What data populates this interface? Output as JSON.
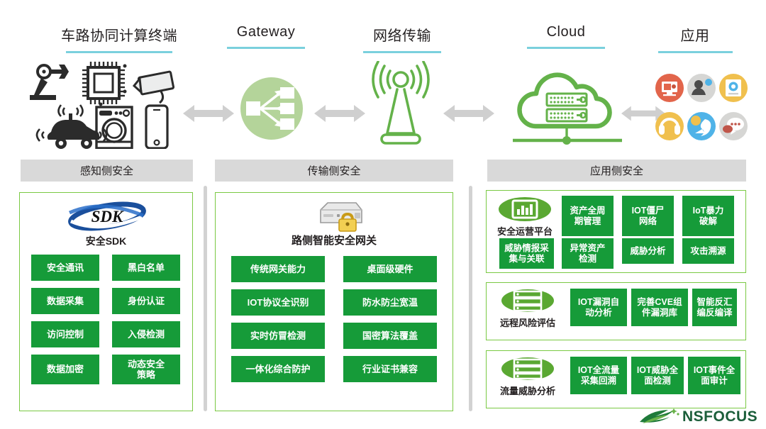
{
  "diagram": {
    "title": "IoT / V2X Security Architecture",
    "accent_green": "#169b39",
    "panel_border_green": "#7ac943",
    "underline_color": "#7ad0dd",
    "banner_bg": "#d9d9d9"
  },
  "columns": [
    {
      "label": "车路协同计算终端",
      "icon": "edge-devices-icon"
    },
    {
      "label": "Gateway",
      "icon": "gateway-distribution-icon"
    },
    {
      "label": "网络传输",
      "icon": "radio-tower-icon"
    },
    {
      "label": "Cloud",
      "icon": "cloud-server-icon"
    },
    {
      "label": "应用",
      "icon": "applications-icon"
    }
  ],
  "banners": [
    {
      "label": "感知侧安全"
    },
    {
      "label": "传输侧安全"
    },
    {
      "label": "应用侧安全"
    }
  ],
  "perception": {
    "logo_text": "SDK",
    "logo_caption": "安全SDK",
    "chips": [
      "安全通讯",
      "黑白名单",
      "数据采集",
      "身份认证",
      "访问控制",
      "入侵检测",
      "数据加密",
      "动态安全\n策略"
    ]
  },
  "transmission": {
    "caption": "路侧智能安全网关",
    "icon": "secure-gateway-lock-icon",
    "chips": [
      "传统网关能力",
      "桌面级硬件",
      "IOT协议全识别",
      "防水防尘宽温",
      "实时仿冒检测",
      "国密算法覆盖",
      "一体化综合防护",
      "行业证书兼容"
    ]
  },
  "application": {
    "groups": [
      {
        "label": "安全运营平台",
        "icon": "dashboard-chart-icon",
        "row1": [
          "资产全周\n期管理",
          "IOT僵尸\n网络",
          "IoT暴力\n破解"
        ],
        "row2": [
          "威胁情报采\n集与关联",
          "异常资产\n检测",
          "威胁分析",
          "攻击溯源"
        ]
      },
      {
        "label": "远程风险评估",
        "icon": "server-stack-icon",
        "row1": [
          "IOT漏洞自\n动分析",
          "完善CVE组\n件漏洞库",
          "智能反汇\n编反编译"
        ]
      },
      {
        "label": "流量威胁分析",
        "icon": "server-stack-icon",
        "row1": [
          "IOT全流量\n采集回溯",
          "IOT威胁全\n面检测",
          "IOT事件全\n面审计"
        ]
      }
    ]
  },
  "footer": {
    "brand": "NSFOCUS",
    "logo_icon": "nsfocus-wave-logo"
  }
}
